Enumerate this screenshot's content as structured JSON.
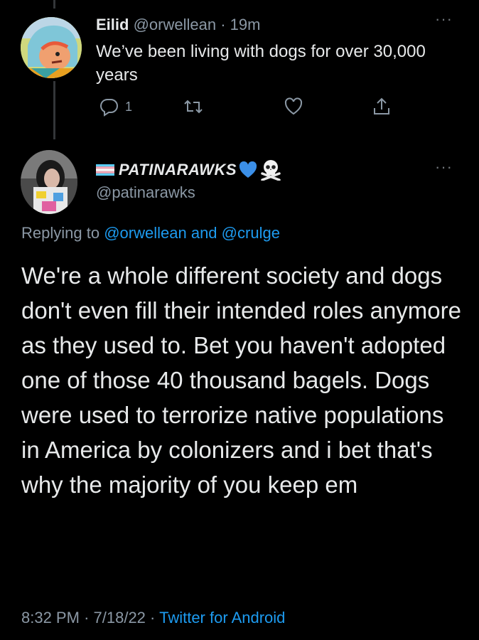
{
  "tweet1": {
    "name": "Eilid",
    "handle": "@orwellean",
    "separator": "·",
    "time": "19m",
    "text": "We’ve been living with dogs for over 30,000 years",
    "reply_count": "1",
    "more": "···"
  },
  "tweet2": {
    "name": "PATINARAWKS",
    "handle": "@patinarawks",
    "replying_prefix": "Replying to",
    "mention1": "@orwellean",
    "and_word": "and",
    "mention2": "@crulge",
    "text": "We're a whole different society and dogs don't even fill their intended roles anymore as they used to. Bet you haven't adopted one of those 40 thousand bagels. Dogs were used to terrorize native populations in America by colonizers and i bet that's why the majority of you keep em",
    "time": "8:32 PM",
    "sep1": "·",
    "date": "7/18/22",
    "sep2": "·",
    "client": "Twitter for Android",
    "more": "···"
  },
  "colors": {
    "background": "#000000",
    "text": "#e7e9ea",
    "secondary": "#8b98a5",
    "link": "#1d9bf0"
  },
  "icons": [
    "reply-icon",
    "retweet-icon",
    "like-icon",
    "share-icon",
    "transgender-flag-emoji",
    "blue-heart-emoji",
    "skull-crossbones-emoji",
    "more-icon"
  ]
}
